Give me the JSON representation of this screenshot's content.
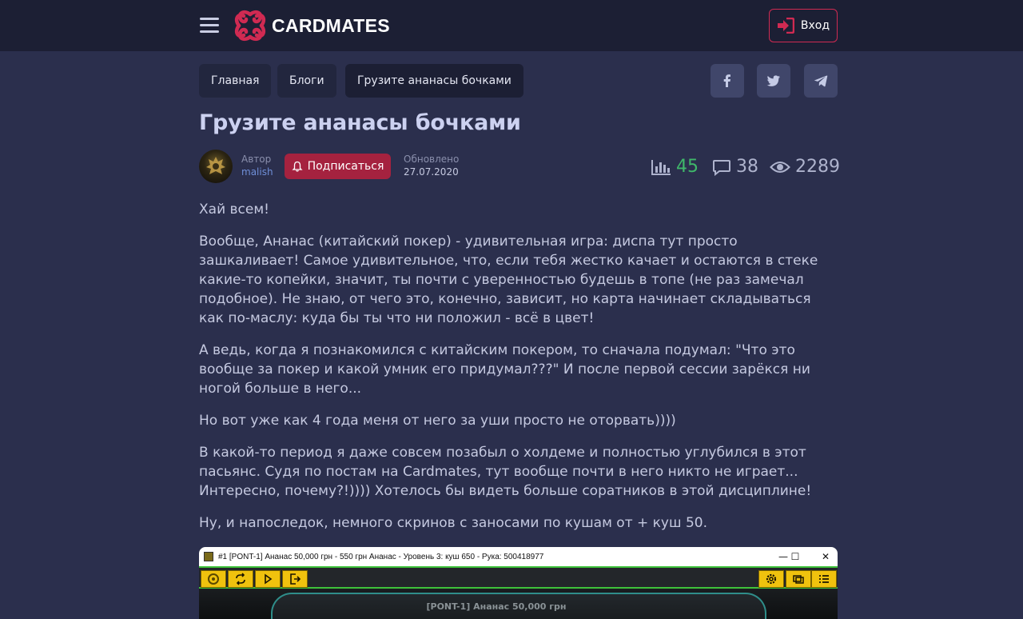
{
  "header": {
    "logo_text": "CARDMATES",
    "login_label": "Вход",
    "brand_color": "#d02a52"
  },
  "breadcrumbs": [
    {
      "label": "Главная"
    },
    {
      "label": "Блоги"
    },
    {
      "label": "Грузите ананасы бочками"
    }
  ],
  "share": {
    "icons": [
      "facebook-icon",
      "twitter-icon",
      "telegram-icon"
    ]
  },
  "post": {
    "title": "Грузите ананасы бочками",
    "author_label": "Автор",
    "author_name": "malish",
    "subscribe_label": "Подписаться",
    "updated_label": "Обновлено",
    "updated_date": "27.07.2020",
    "rating": "45",
    "comments": "38",
    "views": "2289",
    "paragraphs": [
      "Хай всем!",
      "Вообще, Ананас (китайский покер) - удивительная игра: диспа тут просто зашкаливает! Самое удивительное, что, если тебя жестко качает и остаются в стеке какие-то копейки, значит, ты почти с уверенностью будешь в топе (не раз замечал подобное). Не знаю, от чего это, конечно, зависит, но карта начинает складываться как по-маслу: куда бы ты что ни положил - всё в цвет!",
      "А ведь, когда я познакомился с китайским покером, то сначала подумал: \"Что это вообще за покер и какой умник его придумал???\" И после первой сессии зарёкся ни ногой больше в него...",
      "Но вот уже как 4 года меня от него за уши просто не оторвать))))",
      "В какой-то период я даже совсем позабыл о холдеме и полностью углубился в этот пасьянс. Судя по постам на Cardmates, тут вообще почти в него никто не играет... Интересно, почему?!)))) Хотелось бы видеть больше соратников в этой дисциплине!",
      "Ну, и напоследок, немного скринов с заносами по кушам от + куш 50."
    ]
  },
  "screenshot": {
    "window_title": "#1 [PONT-1] Ананас 50,000 грн - 550 грн Ананас - Уровень 3: куш 650 - Рука: 500418977",
    "table_name": "[PONT-1] Ананас 50,000 грн"
  }
}
